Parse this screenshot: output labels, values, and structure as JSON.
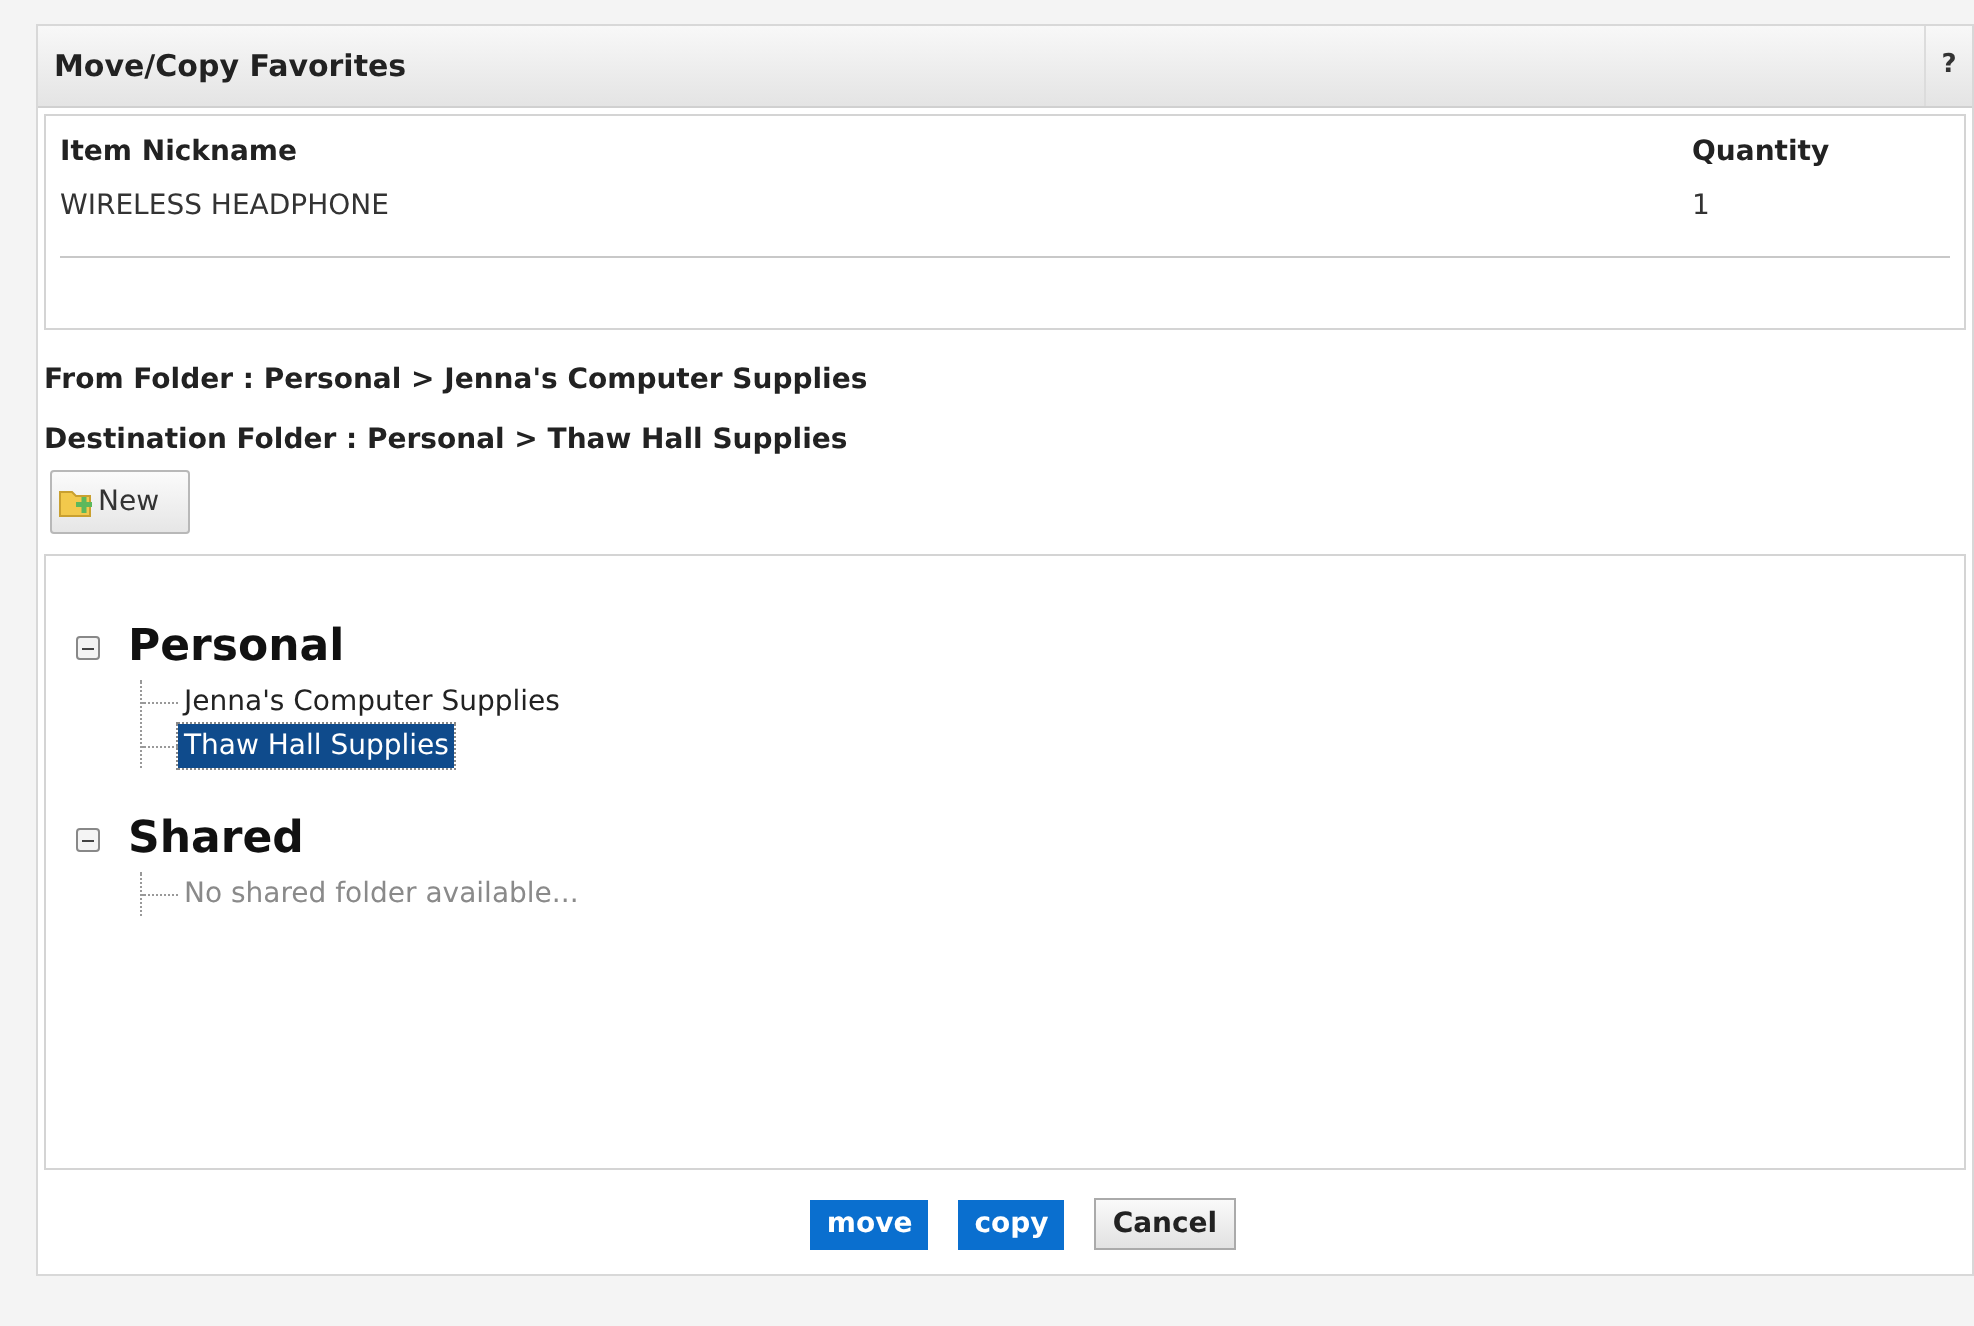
{
  "window": {
    "title": "Move/Copy Favorites",
    "help": "?"
  },
  "items_table": {
    "columns": [
      "Item Nickname",
      "Quantity"
    ],
    "rows": [
      [
        "WIRELESS HEADPHONE",
        "1"
      ]
    ]
  },
  "from_folder": {
    "label": "From Folder :",
    "path": "Personal > Jenna's Computer Supplies"
  },
  "destination_folder": {
    "label": "Destination Folder :",
    "path": "Personal > Thaw Hall Supplies"
  },
  "new_button": {
    "label": "New"
  },
  "tree": [
    {
      "label": "Personal",
      "expanded": true,
      "children": [
        {
          "label": "Jenna's Computer Supplies",
          "kind": "folder",
          "selected": false
        },
        {
          "label": "Thaw Hall Supplies",
          "kind": "folder",
          "selected": true
        }
      ]
    },
    {
      "label": "Shared",
      "expanded": true,
      "children": [
        {
          "label": "No shared folder available...",
          "kind": "empty"
        }
      ]
    }
  ],
  "buttons": [
    {
      "label": "move",
      "kind": "primary"
    },
    {
      "label": "copy",
      "kind": "primary"
    },
    {
      "label": "Cancel",
      "kind": "secondary"
    }
  ]
}
